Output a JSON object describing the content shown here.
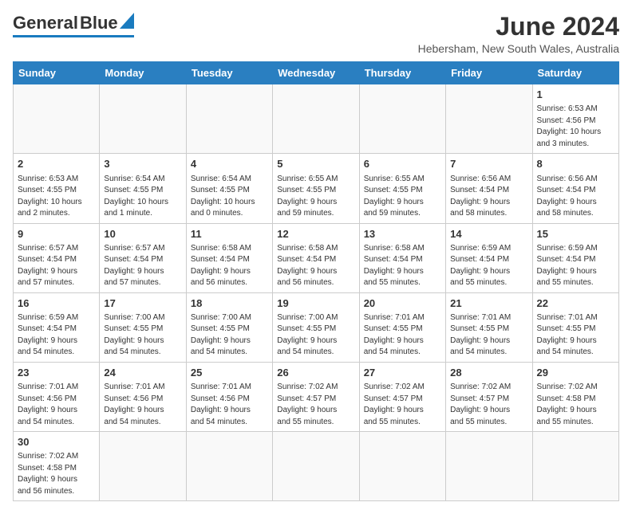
{
  "header": {
    "logo_general": "General",
    "logo_blue": "Blue",
    "month_title": "June 2024",
    "location": "Hebersham, New South Wales, Australia"
  },
  "weekdays": [
    "Sunday",
    "Monday",
    "Tuesday",
    "Wednesday",
    "Thursday",
    "Friday",
    "Saturday"
  ],
  "weeks": [
    [
      {
        "day": "",
        "info": ""
      },
      {
        "day": "",
        "info": ""
      },
      {
        "day": "",
        "info": ""
      },
      {
        "day": "",
        "info": ""
      },
      {
        "day": "",
        "info": ""
      },
      {
        "day": "",
        "info": ""
      },
      {
        "day": "1",
        "info": "Sunrise: 6:53 AM\nSunset: 4:56 PM\nDaylight: 10 hours\nand 3 minutes."
      }
    ],
    [
      {
        "day": "2",
        "info": "Sunrise: 6:53 AM\nSunset: 4:55 PM\nDaylight: 10 hours\nand 2 minutes."
      },
      {
        "day": "3",
        "info": "Sunrise: 6:54 AM\nSunset: 4:55 PM\nDaylight: 10 hours\nand 1 minute."
      },
      {
        "day": "4",
        "info": "Sunrise: 6:54 AM\nSunset: 4:55 PM\nDaylight: 10 hours\nand 0 minutes."
      },
      {
        "day": "5",
        "info": "Sunrise: 6:55 AM\nSunset: 4:55 PM\nDaylight: 9 hours\nand 59 minutes."
      },
      {
        "day": "6",
        "info": "Sunrise: 6:55 AM\nSunset: 4:55 PM\nDaylight: 9 hours\nand 59 minutes."
      },
      {
        "day": "7",
        "info": "Sunrise: 6:56 AM\nSunset: 4:54 PM\nDaylight: 9 hours\nand 58 minutes."
      },
      {
        "day": "8",
        "info": "Sunrise: 6:56 AM\nSunset: 4:54 PM\nDaylight: 9 hours\nand 58 minutes."
      }
    ],
    [
      {
        "day": "9",
        "info": "Sunrise: 6:57 AM\nSunset: 4:54 PM\nDaylight: 9 hours\nand 57 minutes."
      },
      {
        "day": "10",
        "info": "Sunrise: 6:57 AM\nSunset: 4:54 PM\nDaylight: 9 hours\nand 57 minutes."
      },
      {
        "day": "11",
        "info": "Sunrise: 6:58 AM\nSunset: 4:54 PM\nDaylight: 9 hours\nand 56 minutes."
      },
      {
        "day": "12",
        "info": "Sunrise: 6:58 AM\nSunset: 4:54 PM\nDaylight: 9 hours\nand 56 minutes."
      },
      {
        "day": "13",
        "info": "Sunrise: 6:58 AM\nSunset: 4:54 PM\nDaylight: 9 hours\nand 55 minutes."
      },
      {
        "day": "14",
        "info": "Sunrise: 6:59 AM\nSunset: 4:54 PM\nDaylight: 9 hours\nand 55 minutes."
      },
      {
        "day": "15",
        "info": "Sunrise: 6:59 AM\nSunset: 4:54 PM\nDaylight: 9 hours\nand 55 minutes."
      }
    ],
    [
      {
        "day": "16",
        "info": "Sunrise: 6:59 AM\nSunset: 4:54 PM\nDaylight: 9 hours\nand 54 minutes."
      },
      {
        "day": "17",
        "info": "Sunrise: 7:00 AM\nSunset: 4:55 PM\nDaylight: 9 hours\nand 54 minutes."
      },
      {
        "day": "18",
        "info": "Sunrise: 7:00 AM\nSunset: 4:55 PM\nDaylight: 9 hours\nand 54 minutes."
      },
      {
        "day": "19",
        "info": "Sunrise: 7:00 AM\nSunset: 4:55 PM\nDaylight: 9 hours\nand 54 minutes."
      },
      {
        "day": "20",
        "info": "Sunrise: 7:01 AM\nSunset: 4:55 PM\nDaylight: 9 hours\nand 54 minutes."
      },
      {
        "day": "21",
        "info": "Sunrise: 7:01 AM\nSunset: 4:55 PM\nDaylight: 9 hours\nand 54 minutes."
      },
      {
        "day": "22",
        "info": "Sunrise: 7:01 AM\nSunset: 4:55 PM\nDaylight: 9 hours\nand 54 minutes."
      }
    ],
    [
      {
        "day": "23",
        "info": "Sunrise: 7:01 AM\nSunset: 4:56 PM\nDaylight: 9 hours\nand 54 minutes."
      },
      {
        "day": "24",
        "info": "Sunrise: 7:01 AM\nSunset: 4:56 PM\nDaylight: 9 hours\nand 54 minutes."
      },
      {
        "day": "25",
        "info": "Sunrise: 7:01 AM\nSunset: 4:56 PM\nDaylight: 9 hours\nand 54 minutes."
      },
      {
        "day": "26",
        "info": "Sunrise: 7:02 AM\nSunset: 4:57 PM\nDaylight: 9 hours\nand 55 minutes."
      },
      {
        "day": "27",
        "info": "Sunrise: 7:02 AM\nSunset: 4:57 PM\nDaylight: 9 hours\nand 55 minutes."
      },
      {
        "day": "28",
        "info": "Sunrise: 7:02 AM\nSunset: 4:57 PM\nDaylight: 9 hours\nand 55 minutes."
      },
      {
        "day": "29",
        "info": "Sunrise: 7:02 AM\nSunset: 4:58 PM\nDaylight: 9 hours\nand 55 minutes."
      }
    ],
    [
      {
        "day": "30",
        "info": "Sunrise: 7:02 AM\nSunset: 4:58 PM\nDaylight: 9 hours\nand 56 minutes."
      },
      {
        "day": "",
        "info": ""
      },
      {
        "day": "",
        "info": ""
      },
      {
        "day": "",
        "info": ""
      },
      {
        "day": "",
        "info": ""
      },
      {
        "day": "",
        "info": ""
      },
      {
        "day": "",
        "info": ""
      }
    ]
  ]
}
